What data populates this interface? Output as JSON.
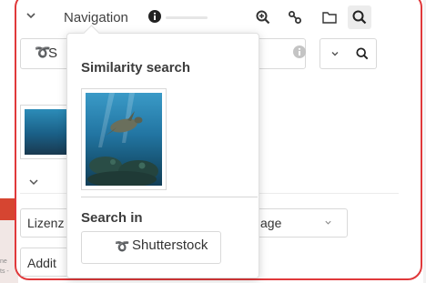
{
  "background": {
    "line1": "ne",
    "line2": "ts -"
  },
  "nav": {
    "label": "Navigation",
    "tools": [
      "zoom-in",
      "link",
      "folder",
      "search"
    ],
    "active_tool": "search"
  },
  "search": {
    "provider_peek": "S"
  },
  "content": {
    "lizenz": "Lizenz",
    "right_field": "age",
    "addit": "Addit"
  },
  "popover": {
    "title": "Similarity search",
    "search_in": "Search in",
    "provider": "Shutterstock"
  },
  "colors": {
    "frame": "#e0393b",
    "brand": "#e33d3c"
  }
}
